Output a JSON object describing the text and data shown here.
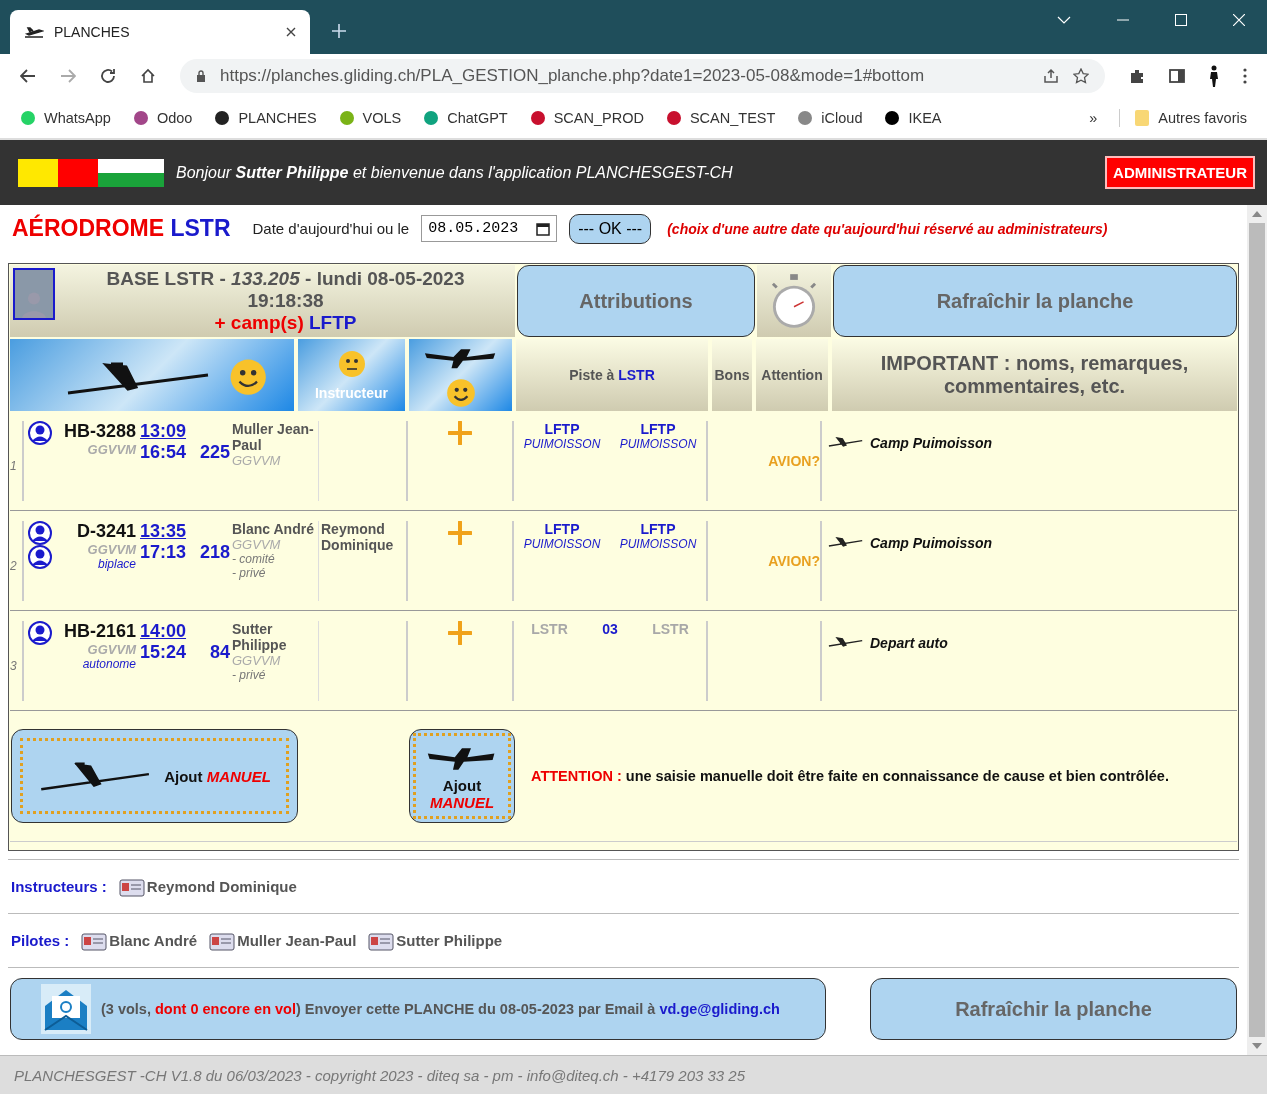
{
  "browser": {
    "tab_title": "PLANCHES",
    "url": "https://planches.gliding.ch/PLA_GESTION_planche.php?date1=2023-05-08&mode=1#bottom",
    "bookmarks": [
      {
        "label": "WhatsApp",
        "color": "#25d366"
      },
      {
        "label": "Odoo",
        "color": "#a24689"
      },
      {
        "label": "PLANCHES",
        "color": "#222222"
      },
      {
        "label": "VOLS",
        "color": "#7ab317"
      },
      {
        "label": "ChatGPT",
        "color": "#10a37f"
      },
      {
        "label": "SCAN_PROD",
        "color": "#c8102e"
      },
      {
        "label": "SCAN_TEST",
        "color": "#c8102e"
      },
      {
        "label": "iCloud",
        "color": "#888888"
      },
      {
        "label": "IKEA",
        "color": "#000000"
      }
    ],
    "more": "»",
    "other_bookmarks": "Autres favoris"
  },
  "header": {
    "greeting": "Bonjour **Sutter Philippe** et bienvenue dans l'application PLANCHESGEST-CH",
    "role_button": "ADMINISTRATEUR"
  },
  "date_bar": {
    "title_main": "AÉRODROME",
    "title_code": "LSTR",
    "label": "Date d'aujourd'hui ou le",
    "date_value": "08.05.2023",
    "ok_button": "--- OK ---",
    "note": "(choix d'une autre date qu'aujourd'hui réservé au administrateurs)"
  },
  "board": {
    "base_line": "BASE LSTR - *133.205* - lundi 08-05-2023",
    "time": "19:18:38",
    "camp_prefix": "+ camp(s)",
    "camp_code": "LFTP",
    "attributions_button": "Attributions",
    "refresh_button": "Rafraîchir la planche",
    "instructor_label": "Instructeur",
    "piste_label": "Piste à",
    "piste_code": "LSTR",
    "bons_label": "Bons",
    "attention_label": "Attention",
    "important_label": "IMPORTANT : noms, remarques, commentaires, etc."
  },
  "flights": [
    {
      "number": "1",
      "two_seat": false,
      "registration": "HB-3288",
      "club": "GGVVM",
      "start": "13:09",
      "end": "16:54",
      "duration": "225",
      "pilot": "Muller Jean-Paul",
      "pilot_club": "GGVVM",
      "piste": [
        {
          "code": "LFTP",
          "place": "PUIMOISSON",
          "dim": false
        },
        {
          "code": "LFTP",
          "place": "PUIMOISSON",
          "dim": false
        }
      ],
      "alert": "AVION?",
      "remark": "Camp Puimoisson"
    },
    {
      "number": "2",
      "two_seat": true,
      "registration": "D-3241",
      "club": "GGVVM",
      "type": "biplace",
      "start": "13:35",
      "end": "17:13",
      "duration": "218",
      "pilot": "Blanc André",
      "pilot_club": "GGVVM",
      "pilot_notes": [
        "- comité",
        "- privé"
      ],
      "instructor": "Reymond Dominique",
      "piste": [
        {
          "code": "LFTP",
          "place": "PUIMOISSON",
          "dim": false
        },
        {
          "code": "LFTP",
          "place": "PUIMOISSON",
          "dim": false
        }
      ],
      "alert": "AVION?",
      "remark": "Camp Puimoisson"
    },
    {
      "number": "3",
      "two_seat": false,
      "registration": "HB-2161",
      "club": "GGVVM",
      "type": "autonome",
      "start": "14:00",
      "end": "15:24",
      "duration": "84",
      "pilot": "Sutter Philippe",
      "pilot_club": "GGVVM",
      "pilot_notes": [
        "- privé"
      ],
      "piste": [
        {
          "code": "LSTR",
          "dim": true
        },
        {
          "code": "03",
          "dim": false
        },
        {
          "code": "LSTR",
          "dim": true
        }
      ],
      "remark": "Depart auto"
    }
  ],
  "manual": {
    "glider_label": "Ajout",
    "glider_emph": "MANUEL",
    "plane_label": "Ajout",
    "plane_emph": "MANUEL",
    "warning_prefix": "ATTENTION :",
    "warning": "une saisie manuelle doit être faite en connaissance de cause et bien contrôlée."
  },
  "instructors": {
    "label": "Instructeurs :",
    "names": [
      "Reymond Dominique"
    ]
  },
  "pilots": {
    "label": "Pilotes :",
    "names": [
      "Blanc André",
      "Muller Jean-Paul",
      "Sutter Philippe"
    ]
  },
  "email": {
    "segments": [
      {
        "kind": "plain",
        "text": "(3 vols, "
      },
      {
        "kind": "alert",
        "text": "dont 0 encore en vol"
      },
      {
        "kind": "plain",
        "text": ") Envoyer cette PLANCHE du 08-05-2023 par Email à "
      },
      {
        "kind": "link",
        "text": "vd.ge@gliding.ch"
      }
    ]
  },
  "refresh_bottom": "Rafraîchir la planche",
  "footer": "PLANCHESGEST -CH V1.8 du 06/03/2023 - copyright 2023 - diteq sa - pm - info@diteq.ch - +4179 203 33 25"
}
